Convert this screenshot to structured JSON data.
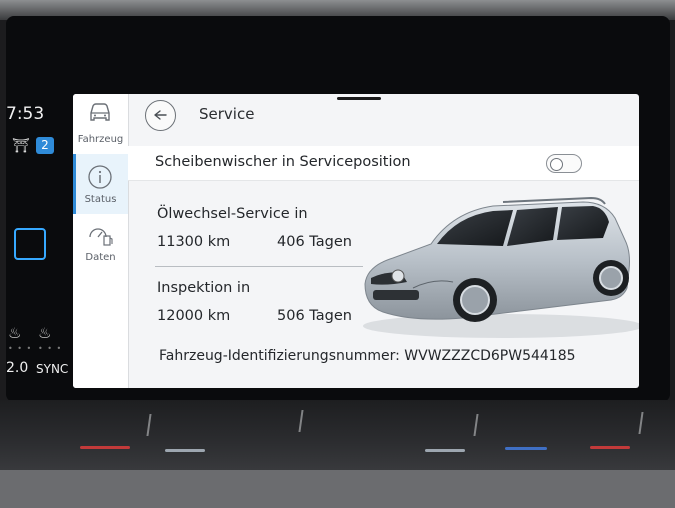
{
  "status_bar": {
    "time": "7:53",
    "seat_icon": "seat-icon",
    "badge_count": "2",
    "temperature": "2.0",
    "sync_label": "SYNC"
  },
  "sidebar": {
    "items": [
      {
        "label": "Fahrzeug",
        "icon": "car-icon",
        "active": false
      },
      {
        "label": "Status",
        "icon": "info-icon",
        "active": true
      },
      {
        "label": "Daten",
        "icon": "fuel-data-icon",
        "active": false
      }
    ]
  },
  "header": {
    "back_icon": "back-arrow-icon",
    "title": "Service"
  },
  "wiper": {
    "label": "Scheibenwischer in Serviceposition",
    "toggle_on": false
  },
  "oil_service": {
    "title": "Ölwechsel-Service in",
    "distance": "11300 km",
    "days": "406 Tagen"
  },
  "inspection": {
    "title": "Inspektion in",
    "distance": "12000 km",
    "days": "506 Tagen"
  },
  "vin": {
    "text": "Fahrzeug-Identifizierungsnummer: WVWZZZCD6PW544185"
  },
  "colors": {
    "accent": "#2f8bd8",
    "panel_bg": "#f4f5f7",
    "car_paint": "#b8c0c8"
  }
}
